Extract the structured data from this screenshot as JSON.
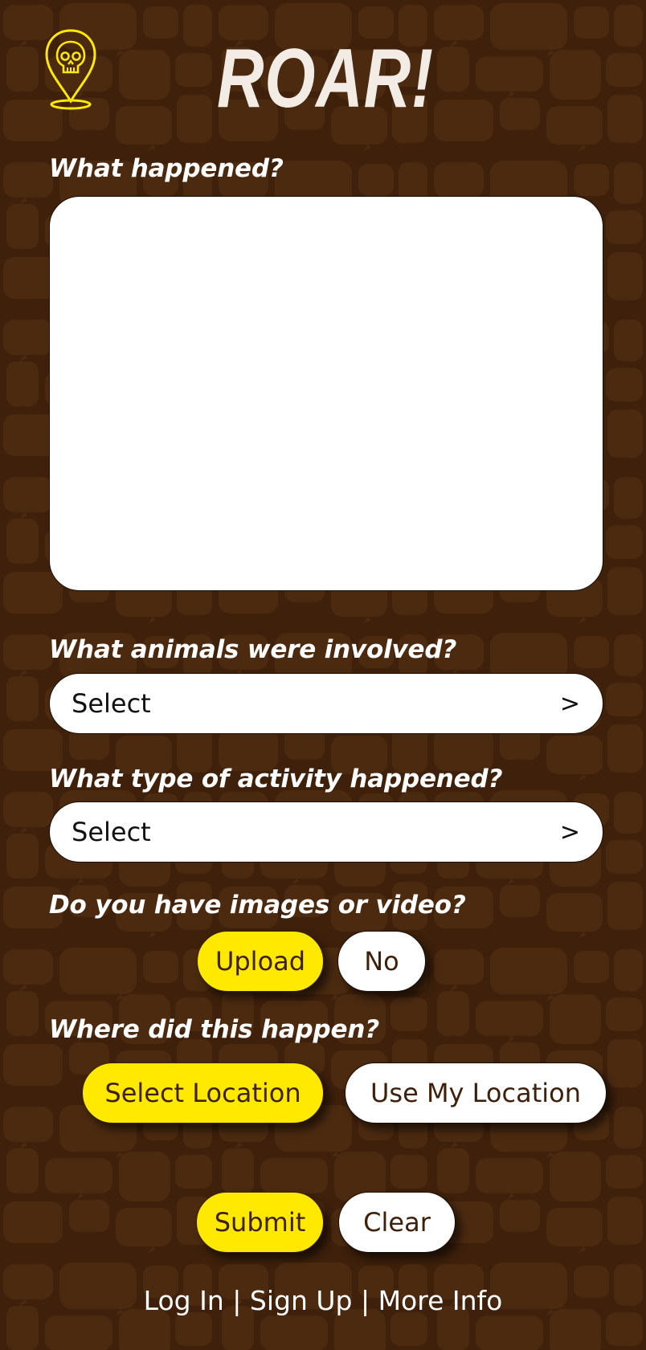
{
  "app": {
    "title": "ROAR!",
    "logo_icon": "skull-location-pin-icon"
  },
  "colors": {
    "background": "#3e200b",
    "accent": "#ffe900",
    "field": "#ffffff",
    "button_text": "#3e200b"
  },
  "form": {
    "what_happened": {
      "label": "What happened?",
      "value": ""
    },
    "animals": {
      "label": "What animals were involved?",
      "value": "Select",
      "chevron": ">"
    },
    "activity": {
      "label": "What type of activity happened?",
      "value": "Select",
      "chevron": ">"
    },
    "media": {
      "label": "Do you have images or video?",
      "upload_label": "Upload",
      "no_label": "No"
    },
    "location": {
      "label": "Where did this happen?",
      "select_label": "Select Location",
      "use_mine_label": "Use My Location"
    },
    "actions": {
      "submit_label": "Submit",
      "clear_label": "Clear"
    }
  },
  "footer": {
    "login": "Log In",
    "signup": "Sign Up",
    "more_info": "More Info",
    "separator": "|"
  }
}
